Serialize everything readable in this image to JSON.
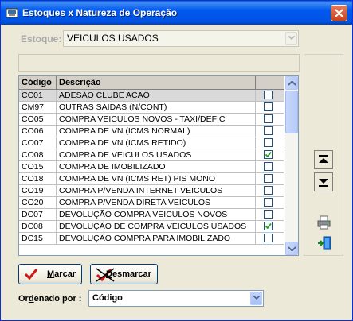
{
  "window": {
    "title": "Estoques x Natureza de Operação"
  },
  "estoque": {
    "label": "Estoque:",
    "value": "VEICULOS USADOS",
    "enabled": false
  },
  "grid": {
    "columns": [
      "Código",
      "Descrição",
      ""
    ],
    "rows": [
      {
        "codigo": "CC01",
        "descricao": "ADESÃO CLUBE ACAO",
        "checked": false,
        "selected": true
      },
      {
        "codigo": "CM97",
        "descricao": "OUTRAS SAIDAS (N/CONT)",
        "checked": false
      },
      {
        "codigo": "CO05",
        "descricao": "COMPRA  VEICULOS NOVOS - TAXI/DEFIC",
        "checked": false
      },
      {
        "codigo": "CO06",
        "descricao": "COMPRA DE VN (ICMS NORMAL)",
        "checked": false
      },
      {
        "codigo": "CO07",
        "descricao": "COMPRA DE VN (ICMS RETIDO)",
        "checked": false
      },
      {
        "codigo": "CO08",
        "descricao": "COMPRA DE VEICULOS USADOS",
        "checked": true
      },
      {
        "codigo": "CO15",
        "descricao": "COMPRA DE IMOBILIZADO",
        "checked": false
      },
      {
        "codigo": "CO18",
        "descricao": "COMPRA DE VN (ICMS RET) PIS MONO",
        "checked": false
      },
      {
        "codigo": "CO19",
        "descricao": "COMPRA P/VENDA INTERNET VEICULOS",
        "checked": false
      },
      {
        "codigo": "CO20",
        "descricao": "COMPRA P/VENDA DIRETA VEICULOS",
        "checked": false
      },
      {
        "codigo": "DC07",
        "descricao": "DEVOLUÇÃO COMPRA VEICULOS NOVOS",
        "checked": false
      },
      {
        "codigo": "DC08",
        "descricao": "DEVOLUÇÃO DE COMPRA VEICULOS USADOS",
        "checked": true
      },
      {
        "codigo": "DC15",
        "descricao": "DEVOLUÇÃO COMPRA PARA IMOBILIZADO",
        "checked": false
      }
    ]
  },
  "buttons": {
    "marcar": "Marcar",
    "desmarcar": "Desmarcar"
  },
  "ordenado": {
    "label": "Ordenado por :",
    "value": "Código"
  },
  "colors": {
    "title_bar": "#0054e3",
    "check_mark": "#21a121",
    "window_bg": "#ece9d8"
  }
}
